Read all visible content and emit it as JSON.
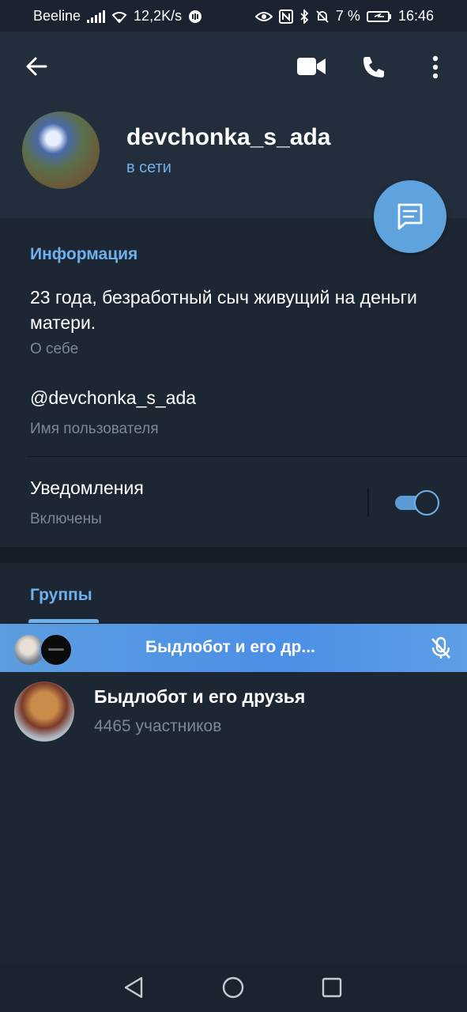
{
  "status_bar": {
    "carrier": "Beeline",
    "speed": "12,2K/s",
    "battery": "7 %",
    "time": "16:46"
  },
  "profile": {
    "name": "devchonka_s_ada",
    "status": "в сети"
  },
  "info": {
    "section_title": "Информация",
    "bio": "23 года, безработный сыч живущий на деньги матери.",
    "bio_label": "О себе",
    "username": "@devchonka_s_ada",
    "username_label": "Имя пользователя",
    "notifications_title": "Уведомления",
    "notifications_state": "Включены",
    "notifications_on": true
  },
  "groups": {
    "section_title": "Группы",
    "voice_chat_title": "Быдлобот и его др...",
    "items": [
      {
        "name": "Быдлобот и его друзья",
        "members": "4465 участников"
      }
    ]
  },
  "colors": {
    "accent": "#6fb1ec",
    "header_bg": "#222e3c",
    "body_bg": "#1d2733",
    "fab": "#5fa3de"
  },
  "icons": [
    "back-arrow-icon",
    "video-call-icon",
    "phone-icon",
    "more-vert-icon",
    "message-icon",
    "mic-off-icon"
  ]
}
